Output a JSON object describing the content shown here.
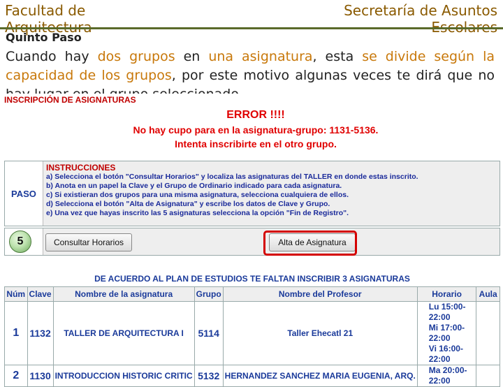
{
  "header": {
    "left_title": "Facultad de Arquitectura",
    "right_title": "Secretaría de Asuntos Escolares"
  },
  "subtitle": "Quinto Paso",
  "paragraph": {
    "p1": "Cuando hay ",
    "h1": "dos grupos",
    "p2": " en ",
    "h2": "una asignatura",
    "p3": ", esta ",
    "h3": "se divide según la capacidad de los grupos",
    "p4": ", por este motivo algunas veces te dirá que no hay lugar en el grupo seleccionado."
  },
  "section_title": "INSCRIPCIÓN DE ASIGNATURAS",
  "error": {
    "line1": "ERROR !!!!",
    "line2": "No hay cupo para en la asignatura-grupo: 1131-5136.",
    "line3": "Intenta inscribirte en el otro grupo."
  },
  "instructions": {
    "paso_label": "PASO",
    "title": "INSTRUCCIONES",
    "lines": [
      "a) Selecciona el botón \"Consultar Horarios\" y localiza las asignaturas del TALLER en donde estas inscrito.",
      "b) Anota en un papel la Clave y el Grupo de Ordinario indicado para cada asignatura.",
      "c) Si existieran dos grupos para una misma asignatura, selecciona cualquiera de ellos.",
      "d) Selecciona el botón \"Alta de Asignatura\" y escribe los datos de Clave y Grupo.",
      "e) Una vez que hayas inscrito las 5 asignaturas selecciona la opción \"Fin de Registro\"."
    ]
  },
  "step": {
    "number": "5",
    "consult_label": "Consultar Horarios",
    "alta_label": "Alta de Asignatura"
  },
  "plan_title": "DE ACUERDO AL PLAN DE ESTUDIOS TE FALTAN INSCRIBIR 3 ASIGNATURAS",
  "table": {
    "headers": [
      "Núm",
      "Clave",
      "Nombre de la asignatura",
      "Grupo",
      "Nombre del Profesor",
      "Horario",
      "Aula"
    ],
    "rows": [
      {
        "num": "1",
        "clave": "1132",
        "nombre": "TALLER DE ARQUITECTURA I",
        "grupo": "5114",
        "profesor": "Taller Ehecatl 21",
        "horario": [
          "Lu 15:00-22:00",
          "Mi 17:00-22:00",
          "Vi 16:00-22:00"
        ],
        "aula": ""
      },
      {
        "num": "2",
        "clave": "1130",
        "nombre": "INTRODUCCION HISTORIC CRITIC",
        "grupo": "5132",
        "profesor": "HERNANDEZ SANCHEZ MARIA EUGENIA, ARQ.",
        "horario": [
          "Ma 20:00-22:00"
        ],
        "aula": ""
      }
    ]
  },
  "colors": {
    "accent_orange": "#c8780a",
    "error_red": "#e00000",
    "ui_blue": "#1a3a9a",
    "highlight_ring": "#d40000"
  }
}
